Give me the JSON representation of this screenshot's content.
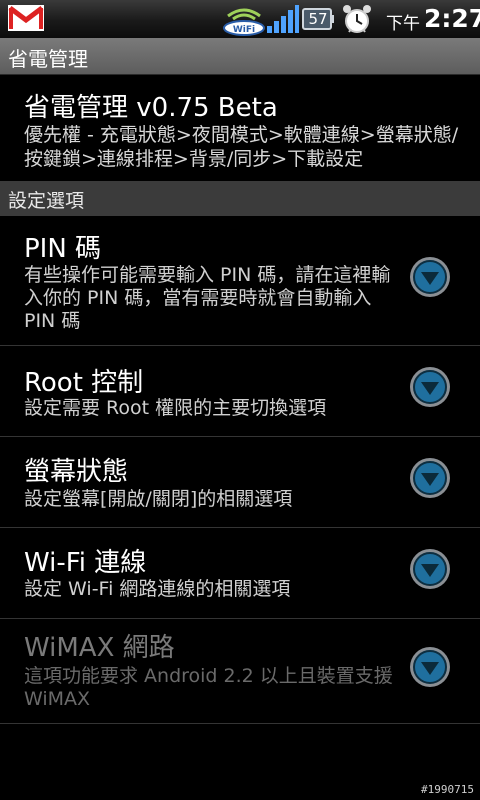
{
  "status_bar": {
    "notification_icon": "gmail-icon",
    "wifi_label": "WiFi",
    "battery_level": "57",
    "time_ampm": "下午",
    "time": "2:27"
  },
  "titlebar": {
    "title": "省電管理"
  },
  "header": {
    "title": "省電管理 v0.75 Beta",
    "summary": "優先權 - 充電狀態>夜間模式>軟體連線>螢幕狀態/按鍵鎖>連線排程>背景/同步>下載設定"
  },
  "category": {
    "label": "設定選項"
  },
  "prefs": [
    {
      "title": "PIN 碼",
      "summary": "有些操作可能需要輸入 PIN 碼，請在這裡輸入你的 PIN 碼，當有需要時就會自動輸入 PIN 碼",
      "enabled": true
    },
    {
      "title": "Root 控制",
      "summary": "設定需要 Root 權限的主要切換選項",
      "enabled": true
    },
    {
      "title": "螢幕狀態",
      "summary": "設定螢幕[開啟/關閉]的相關選項",
      "enabled": true
    },
    {
      "title": "Wi-Fi 連線",
      "summary": "設定 Wi-Fi 網路連線的相關選項",
      "enabled": true
    },
    {
      "title": "WiMAX 網路",
      "summary": "這項功能要求 Android 2.2 以上且裝置支援 WiMAX",
      "enabled": false
    }
  ],
  "colors": {
    "arrow_ring": "#8a8f94",
    "arrow_fill": "#1f6f9e",
    "arrow_glyph": "#0b2a3a"
  },
  "watermark": "#1990715"
}
